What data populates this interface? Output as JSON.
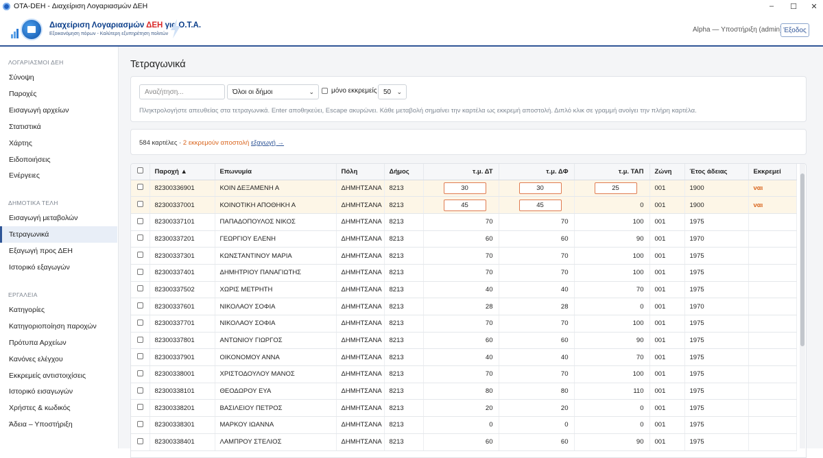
{
  "window": {
    "title": "OTA-DEH - Διαχείριση Λογαριασμών ΔΕΗ",
    "minimize": "–",
    "maximize": "☐",
    "close": "✕"
  },
  "header": {
    "logo_title_prefix": "Διαχείριση Λογαριασμών",
    "logo_title_brand": "ΔΕΗ",
    "logo_title_suffix": "για Ο.Τ.Α.",
    "logo_subtitle": "Εξοικονόμηση πόρων - Καλύτερη εξυπηρέτηση πολιτών",
    "user": "Alpha — Υποστήριξη (admin)",
    "logout": "Έξοδος"
  },
  "sidebar": {
    "sections": [
      {
        "title": "ΛΟΓΑΡΙΑΣΜΟΙ ΔΕΗ",
        "items": [
          "Σύνοψη",
          "Παροχές",
          "Εισαγωγή αρχείων",
          "Στατιστικά",
          "Χάρτης",
          "Ειδοποιήσεις",
          "Ενέργειες"
        ]
      },
      {
        "title": "ΔΗΜΟΤΙΚΑ ΤΕΛΗ",
        "items": [
          "Εισαγωγή μεταβολών",
          "Τετραγωνικά",
          "Εξαγωγή προς ΔΕΗ",
          "Ιστορικό εξαγωγών"
        ]
      },
      {
        "title": "ΕΡΓΑΛΕΙΑ",
        "items": [
          "Κατηγορίες",
          "Κατηγοριοποίηση παροχών",
          "Πρότυπα Αρχείων",
          "Κανόνες ελέγχου",
          "Εκκρεμείς αντιστοιχίσεις",
          "Ιστορικό εισαγωγών",
          "Χρήστες & κωδικός",
          "Άδεια – Υποστήριξη"
        ]
      }
    ],
    "active": "Τετραγωνικά"
  },
  "page": {
    "title": "Τετραγωνικά"
  },
  "filters": {
    "search_placeholder": "Αναζήτηση...",
    "municipality": "Όλοι οι δήμοι",
    "pending_only_label": "μόνο εκκρεμείς",
    "page_size": "50",
    "hint": "Πληκτρολογήστε απευθείας στα τετραγωνικά. Enter αποθηκεύει, Escape ακυρώνει. Κάθε μεταβολή σημαίνει την καρτέλα ως εκκρεμή αποστολή. Διπλό κλικ σε γραμμή ανοίγει την πλήρη καρτέλα."
  },
  "summary": {
    "count": "584 καρτέλες ·",
    "pending": "2 εκκρεμούν αποστολή",
    "export": "εξαγωγή →"
  },
  "table": {
    "headers": [
      "Παροχή ▲",
      "Επωνυμία",
      "Πόλη",
      "Δήμος",
      "τ.μ. ΔΤ",
      "τ.μ. ΔΦ",
      "τ.μ. ΤΑΠ",
      "Ζώνη",
      "Έτος άδειας",
      "Εκκρεμεί"
    ],
    "rows": [
      {
        "id": "82300336901",
        "name": "ΚΟΙΝ ΔΕΞΑΜΕΝΗ Α",
        "city": "ΔΗΜΗΤΣΑΝΑ",
        "mun": "8213",
        "dt": "30",
        "df": "30",
        "tap": "25",
        "zone": "001",
        "year": "1900",
        "pending": "ναι",
        "edit": [
          true,
          true,
          true
        ]
      },
      {
        "id": "82300337001",
        "name": "ΚΟΙΝΟΤΙΚΗ ΑΠΟΘΗΚΗ Α",
        "city": "ΔΗΜΗΤΣΑΝΑ",
        "mun": "8213",
        "dt": "45",
        "df": "45",
        "tap": "0",
        "zone": "001",
        "year": "1900",
        "pending": "ναι",
        "edit": [
          true,
          true,
          false
        ]
      },
      {
        "id": "82300337101",
        "name": "ΠΑΠΑΔΟΠΟΥΛΟΣ ΝΙΚΟΣ",
        "city": "ΔΗΜΗΤΣΑΝΑ",
        "mun": "8213",
        "dt": "70",
        "df": "70",
        "tap": "100",
        "zone": "001",
        "year": "1975",
        "pending": ""
      },
      {
        "id": "82300337201",
        "name": "ΓΕΩΡΓΙΟΥ ΕΛΕΝΗ",
        "city": "ΔΗΜΗΤΣΑΝΑ",
        "mun": "8213",
        "dt": "60",
        "df": "60",
        "tap": "90",
        "zone": "001",
        "year": "1970",
        "pending": ""
      },
      {
        "id": "82300337301",
        "name": "ΚΩΝΣΤΑΝΤΙΝΟΥ ΜΑΡΙΑ",
        "city": "ΔΗΜΗΤΣΑΝΑ",
        "mun": "8213",
        "dt": "70",
        "df": "70",
        "tap": "100",
        "zone": "001",
        "year": "1975",
        "pending": ""
      },
      {
        "id": "82300337401",
        "name": "ΔΗΜΗΤΡΙΟΥ ΠΑΝΑΓΙΩΤΗΣ",
        "city": "ΔΗΜΗΤΣΑΝΑ",
        "mun": "8213",
        "dt": "70",
        "df": "70",
        "tap": "100",
        "zone": "001",
        "year": "1975",
        "pending": ""
      },
      {
        "id": "82300337502",
        "name": "ΧΩΡΙΣ ΜΕΤΡΗΤΗ",
        "city": "ΔΗΜΗΤΣΑΝΑ",
        "mun": "8213",
        "dt": "40",
        "df": "40",
        "tap": "70",
        "zone": "001",
        "year": "1975",
        "pending": ""
      },
      {
        "id": "82300337601",
        "name": "ΝΙΚΟΛΑΟΥ ΣΟΦΙΑ",
        "city": "ΔΗΜΗΤΣΑΝΑ",
        "mun": "8213",
        "dt": "28",
        "df": "28",
        "tap": "0",
        "zone": "001",
        "year": "1970",
        "pending": ""
      },
      {
        "id": "82300337701",
        "name": "ΝΙΚΟΛΑΟΥ ΣΟΦΙΑ",
        "city": "ΔΗΜΗΤΣΑΝΑ",
        "mun": "8213",
        "dt": "70",
        "df": "70",
        "tap": "100",
        "zone": "001",
        "year": "1975",
        "pending": ""
      },
      {
        "id": "82300337801",
        "name": "ΑΝΤΩΝΙΟΥ ΓΙΩΡΓΟΣ",
        "city": "ΔΗΜΗΤΣΑΝΑ",
        "mun": "8213",
        "dt": "60",
        "df": "60",
        "tap": "90",
        "zone": "001",
        "year": "1975",
        "pending": ""
      },
      {
        "id": "82300337901",
        "name": "ΟΙΚΟΝΟΜΟΥ ΑΝΝΑ",
        "city": "ΔΗΜΗΤΣΑΝΑ",
        "mun": "8213",
        "dt": "40",
        "df": "40",
        "tap": "70",
        "zone": "001",
        "year": "1975",
        "pending": ""
      },
      {
        "id": "82300338001",
        "name": "ΧΡΙΣΤΟΔΟΥΛΟΥ ΜΑΝΟΣ",
        "city": "ΔΗΜΗΤΣΑΝΑ",
        "mun": "8213",
        "dt": "70",
        "df": "70",
        "tap": "100",
        "zone": "001",
        "year": "1975",
        "pending": ""
      },
      {
        "id": "82300338101",
        "name": "ΘΕΟΔΩΡΟΥ ΕΥΑ",
        "city": "ΔΗΜΗΤΣΑΝΑ",
        "mun": "8213",
        "dt": "80",
        "df": "80",
        "tap": "110",
        "zone": "001",
        "year": "1975",
        "pending": ""
      },
      {
        "id": "82300338201",
        "name": "ΒΑΣΙΛΕΙΟΥ ΠΕΤΡΟΣ",
        "city": "ΔΗΜΗΤΣΑΝΑ",
        "mun": "8213",
        "dt": "20",
        "df": "20",
        "tap": "0",
        "zone": "001",
        "year": "1975",
        "pending": ""
      },
      {
        "id": "82300338301",
        "name": "ΜΑΡΚΟΥ ΙΩΑΝΝΑ",
        "city": "ΔΗΜΗΤΣΑΝΑ",
        "mun": "8213",
        "dt": "0",
        "df": "0",
        "tap": "0",
        "zone": "001",
        "year": "1975",
        "pending": ""
      },
      {
        "id": "82300338401",
        "name": "ΛΑΜΠΡΟΥ ΣΤΕΛΙΟΣ",
        "city": "ΔΗΜΗΤΣΑΝΑ",
        "mun": "8213",
        "dt": "60",
        "df": "60",
        "tap": "90",
        "zone": "001",
        "year": "1975",
        "pending": ""
      }
    ]
  },
  "colors": {
    "accent": "#2f5597",
    "pending": "#d9641c",
    "pending_row": "#fdf6e7"
  }
}
